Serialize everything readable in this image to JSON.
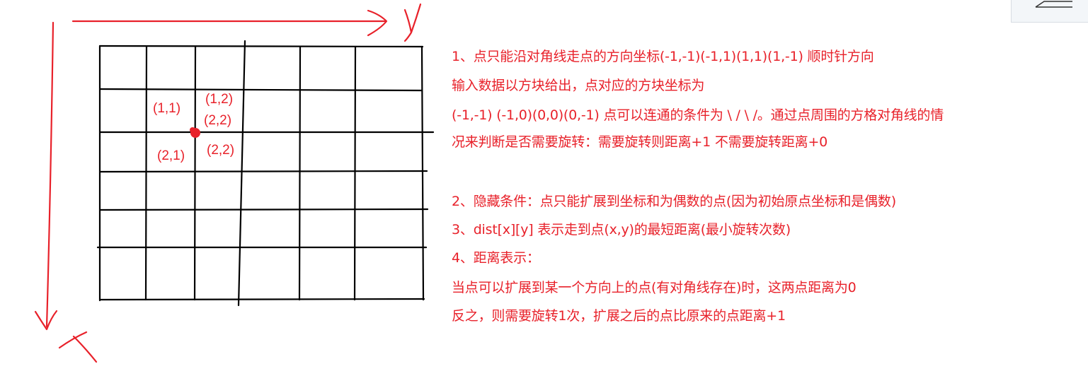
{
  "axes": {
    "y_label": "y",
    "x_label": "x"
  },
  "point_labels": [
    "(1,1)",
    "(1,2)",
    "(2,2)",
    "(2,1)",
    "(2,2)"
  ],
  "notes": [
    "1、点只能沿对角线走点的方向坐标(-1,-1)(-1,1)(1,1)(1,-1) 顺时针方向",
    "输入数据以方块给出，点对应的方块坐标为",
    "(-1,-1) (-1,0)(0,0)(0,-1)   点可以连通的条件为 \\ / \\ /。通过点周围的方格对角线的情",
    "况来判断是否需要旋转：需要旋转则距离+1  不需要旋转距离+0",
    "2、隐藏条件：点只能扩展到坐标和为偶数的点(因为初始原点坐标和是偶数)",
    "3、dist[x][y] 表示走到点(x,y)的最短距离(最小旋转次数)",
    "4、距离表示：",
    "当点可以扩展到某一个方向上的点(有对角线存在)时，这两点距离为0",
    "反之，则需要旋转1次，扩展之后的点比原来的点距离+1"
  ],
  "colors": {
    "annotation": "#e8212a",
    "grid": "#000000"
  }
}
